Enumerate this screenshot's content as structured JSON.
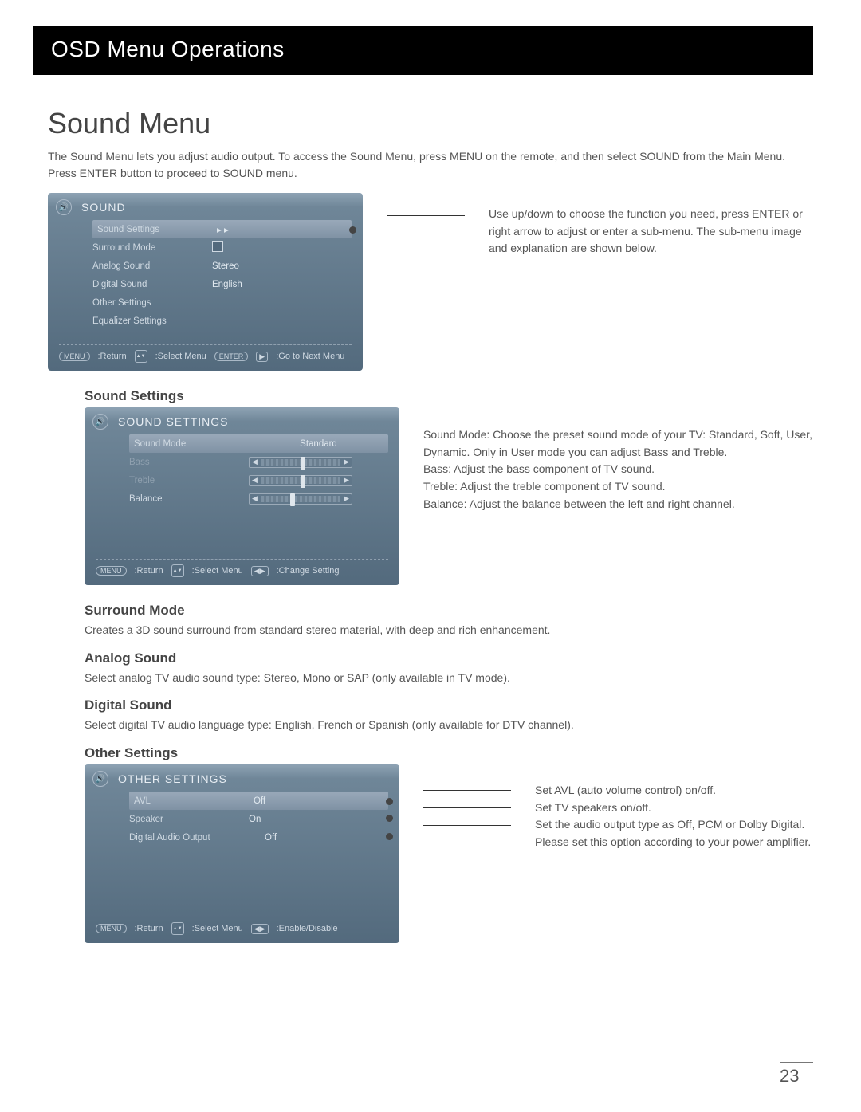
{
  "header": {
    "title": "OSD Menu Operations"
  },
  "page": {
    "title": "Sound Menu",
    "intro": "The Sound Menu lets you adjust audio output. To access the Sound Menu, press MENU on the remote, and then select SOUND from the Main Menu. Press ENTER button to proceed to SOUND menu."
  },
  "sound_menu_panel": {
    "title": "SOUND",
    "items": [
      {
        "label": "Sound Settings",
        "value": "▸ ▸",
        "selected": true
      },
      {
        "label": "Surround Mode",
        "value_type": "checkbox"
      },
      {
        "label": "Analog Sound",
        "value": "Stereo"
      },
      {
        "label": "Digital Sound",
        "value": "English"
      },
      {
        "label": "Other Settings"
      },
      {
        "label": "Equalizer Settings"
      }
    ],
    "footer": {
      "menu_btn": "MENU",
      "return": ":Return",
      "select": ":Select Menu",
      "enter_btn": "ENTER",
      "goto": ":Go to Next Menu"
    }
  },
  "sound_menu_desc": "Use up/down to choose the function you need, press ENTER or right arrow to adjust or enter a sub-menu. The sub-menu image and explanation are shown below.",
  "sound_settings": {
    "heading": "Sound Settings",
    "panel_title": "SOUND SETTINGS",
    "items": [
      {
        "label": "Sound Mode",
        "value": "Standard",
        "selected": true
      },
      {
        "label": "Bass",
        "value_type": "slider",
        "disabled": true
      },
      {
        "label": "Treble",
        "value_type": "slider",
        "disabled": true
      },
      {
        "label": "Balance",
        "value_type": "slider"
      }
    ],
    "footer": {
      "menu_btn": "MENU",
      "return": ":Return",
      "select": ":Select Menu",
      "change": ":Change Setting"
    },
    "desc_lines": [
      "Sound Mode: Choose the preset sound mode of your TV: Standard, Soft, User, Dynamic. Only in User mode you can adjust Bass and Treble.",
      "Bass: Adjust the bass component of TV sound.",
      "Treble: Adjust the treble component of TV sound.",
      "Balance: Adjust the balance between the left and right channel."
    ]
  },
  "surround": {
    "heading": "Surround Mode",
    "desc": "Creates a 3D sound surround from standard stereo material, with deep and rich enhancement."
  },
  "analog": {
    "heading": "Analog Sound",
    "desc": "Select analog TV audio sound type: Stereo, Mono or SAP (only available in TV mode)."
  },
  "digital": {
    "heading": "Digital Sound",
    "desc": "Select digital TV audio language type: English, French or Spanish (only available for DTV channel)."
  },
  "other": {
    "heading": "Other Settings",
    "panel_title": "OTHER SETTINGS",
    "items": [
      {
        "label": "AVL",
        "value": "Off",
        "selected": true
      },
      {
        "label": "Speaker",
        "value": "On"
      },
      {
        "label": "Digital Audio Output",
        "value": "Off"
      }
    ],
    "footer": {
      "menu_btn": "MENU",
      "return": ":Return",
      "select": ":Select Menu",
      "enable": ":Enable/Disable"
    },
    "callouts": [
      "Set AVL (auto volume control) on/off.",
      "Set TV speakers on/off.",
      "Set the audio output type as Off, PCM or Dolby Digital. Please set this option according to your power amplifier."
    ]
  },
  "page_number": "23"
}
